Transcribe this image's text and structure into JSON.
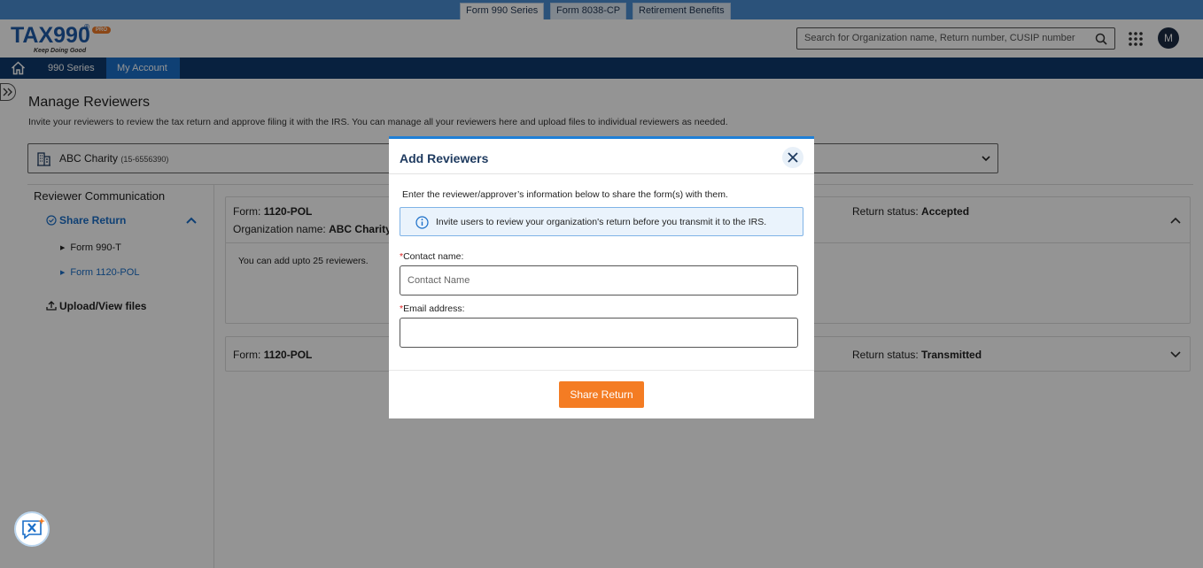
{
  "product_tabs": [
    {
      "label": "Form 990 Series",
      "active": true
    },
    {
      "label": "Form 8038-CP",
      "active": false
    },
    {
      "label": "Retirement Benefits",
      "active": false
    }
  ],
  "header": {
    "logo_text": "TAX990",
    "logo_reg": "®",
    "logo_badge": "PRO",
    "logo_tagline": "Keep Doing Good",
    "search_placeholder": "Search for Organization name, Return number, CUSIP number",
    "avatar_initial": "M"
  },
  "nav": {
    "items": [
      {
        "label": "990 Series",
        "active": false
      },
      {
        "label": "My Account",
        "active": true
      }
    ]
  },
  "page": {
    "title": "Manage Reviewers",
    "subtitle": "Invite your reviewers to review the tax return and approve filing it with the IRS. You can manage all your reviewers here and upload files to individual reviewers as needed.",
    "org_name": "ABC Charity",
    "org_ein": "(15-6556390)"
  },
  "sidebar": {
    "title": "Reviewer Communication",
    "share_return": "Share Return",
    "forms": [
      {
        "label": "Form 990-T",
        "selected": false
      },
      {
        "label": "Form 1120-POL",
        "selected": true
      }
    ],
    "upload": "Upload/View files"
  },
  "cards": [
    {
      "form_label": "Form:",
      "form_value": "1120-POL",
      "org_label": "Organization name:",
      "org_value": "ABC Charity",
      "status_label": "Return status:",
      "status_value": "Accepted",
      "note": "You can add upto 25 reviewers."
    },
    {
      "form_label": "Form:",
      "form_value": "1120-POL",
      "status_label": "Return status:",
      "status_value": "Transmitted"
    }
  ],
  "modal": {
    "title": "Add Reviewers",
    "instruction": "Enter the reviewer/approver’s information below to share the form(s) with them.",
    "info": "Invite users to review your organization's return before you transmit it to the IRS.",
    "contact_label": "Contact name:",
    "contact_placeholder": "Contact Name",
    "contact_value": "",
    "email_label": "Email address:",
    "email_placeholder": "",
    "email_value": "",
    "required_mark": "*",
    "share_button": "Share Return"
  },
  "colors": {
    "primary": "#1a6ec8",
    "navbar": "#0e3a6d",
    "accent": "#f47c23"
  }
}
